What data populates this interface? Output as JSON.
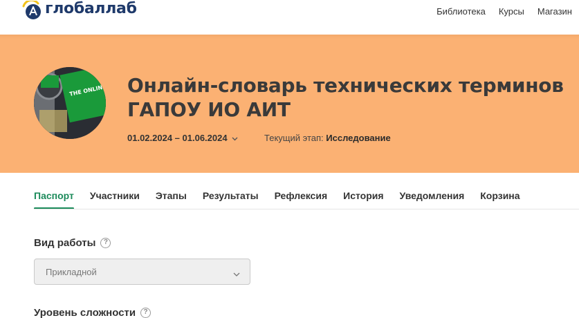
{
  "brand": {
    "name": "глобаллаб"
  },
  "nav": {
    "items": [
      "Библиотека",
      "Курсы",
      "Магазин"
    ]
  },
  "hero": {
    "background_color": "#fbb173",
    "avatar_text": "THE ONLINE DICTIONARY",
    "title": "Онлайн-словарь технических терминов ГАПОУ ИО АИТ",
    "dates": "01.02.2024 – 01.06.2024",
    "stage_label": "Текущий этап:",
    "stage_value": "Исследование"
  },
  "tabs": {
    "active": "Паспорт",
    "items": [
      "Паспорт",
      "Участники",
      "Этапы",
      "Результаты",
      "Рефлексия",
      "История",
      "Уведомления",
      "Корзина"
    ]
  },
  "form": {
    "work_type": {
      "label": "Вид работы",
      "value": "Прикладной"
    },
    "difficulty": {
      "label": "Уровень сложности"
    }
  },
  "colors": {
    "accent_green": "#1b8a5a",
    "logo_navy": "#1f3a6b",
    "logo_yellow": "#f2c21b"
  }
}
